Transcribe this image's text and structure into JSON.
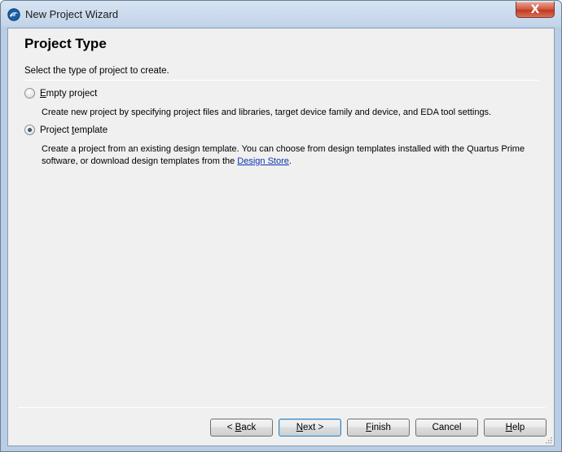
{
  "window": {
    "title": "New Project Wizard",
    "close_glyph": "X"
  },
  "page": {
    "title": "Project Type",
    "subtitle": "Select the type of project to create."
  },
  "options": [
    {
      "label_accel": "E",
      "label_rest": "mpty project",
      "selected": false,
      "description": "Create new project by specifying project files and libraries, target device family and device, and EDA tool settings."
    },
    {
      "label_pre": "Project ",
      "label_accel": "t",
      "label_rest": "emplate",
      "selected": true,
      "description_pre": "Create a project from an existing design template. You can choose from design templates installed with the Quartus Prime software, or download design templates from the ",
      "link_text": "Design Store",
      "description_post": "."
    }
  ],
  "buttons": {
    "back": {
      "prefix": "< ",
      "accel": "B",
      "rest": "ack"
    },
    "next": {
      "accel": "N",
      "rest": "ext >"
    },
    "finish": {
      "accel": "F",
      "rest": "inish"
    },
    "cancel": {
      "label": "Cancel"
    },
    "help": {
      "accel": "H",
      "rest": "elp"
    }
  },
  "colors": {
    "link": "#0b35b0",
    "close_button": "#c0391f",
    "default_button_border": "#3c7fb1"
  },
  "icons": {
    "app": "quartus-app-icon",
    "close": "close-icon",
    "grip": "resize-grip-icon"
  }
}
